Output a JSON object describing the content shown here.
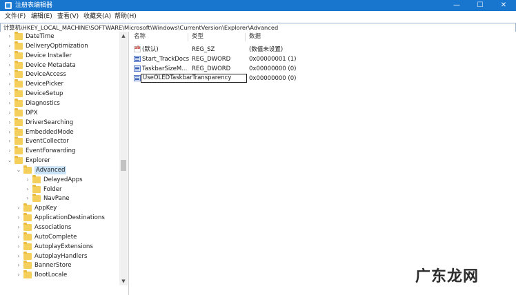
{
  "window": {
    "title": "注册表编辑器"
  },
  "window_controls": {
    "minimize": "—",
    "maximize": "☐",
    "close": "✕"
  },
  "menu": [
    "文件(F)",
    "编辑(E)",
    "查看(V)",
    "收藏夹(A)",
    "帮助(H)"
  ],
  "address": "计算机\\HKEY_LOCAL_MACHINE\\SOFTWARE\\Microsoft\\Windows\\CurrentVersion\\Explorer\\Advanced",
  "tree": {
    "items": [
      {
        "label": "DateTime",
        "expanded": false
      },
      {
        "label": "DeliveryOptimization",
        "expanded": false
      },
      {
        "label": "Device Installer",
        "expanded": false
      },
      {
        "label": "Device Metadata",
        "expanded": false
      },
      {
        "label": "DeviceAccess",
        "expanded": false
      },
      {
        "label": "DevicePicker",
        "expanded": false
      },
      {
        "label": "DeviceSetup",
        "expanded": false
      },
      {
        "label": "Diagnostics",
        "expanded": false
      },
      {
        "label": "DPX",
        "expanded": false
      },
      {
        "label": "DriverSearching",
        "expanded": false
      },
      {
        "label": "EmbeddedMode",
        "expanded": false
      },
      {
        "label": "EventCollector",
        "expanded": false
      },
      {
        "label": "EventForwarding",
        "expanded": false
      },
      {
        "label": "Explorer",
        "expanded": true
      },
      {
        "label": "Advanced",
        "expanded": true,
        "selected": true
      },
      {
        "label": "DelayedApps",
        "expanded": false
      },
      {
        "label": "Folder",
        "expanded": false
      },
      {
        "label": "NavPane",
        "expanded": false
      },
      {
        "label": "AppKey",
        "expanded": false
      },
      {
        "label": "ApplicationDestinations",
        "expanded": false
      },
      {
        "label": "Associations",
        "expanded": false
      },
      {
        "label": "AutoComplete",
        "expanded": false
      },
      {
        "label": "AutoplayExtensions",
        "expanded": false
      },
      {
        "label": "AutoplayHandlers",
        "expanded": false
      },
      {
        "label": "BannerStore",
        "expanded": false
      },
      {
        "label": "BootLocale",
        "expanded": false
      }
    ]
  },
  "values_table": {
    "headers": [
      "名称",
      "类型",
      "数据"
    ],
    "rows": [
      {
        "icon": "string-value-icon",
        "name": "(默认)",
        "type": "REG_SZ",
        "data": "(数值未设置)"
      },
      {
        "icon": "dword-value-icon",
        "name": "Start_TrackDocs",
        "type": "REG_DWORD",
        "data": "0x00000001 (1)"
      },
      {
        "icon": "dword-value-icon",
        "name": "TaskbarSizeM...",
        "type": "REG_DWORD",
        "data": "0x00000000 (0)"
      },
      {
        "icon": "dword-value-icon",
        "name": "UseOLEDTaskbarTransparency",
        "type": "",
        "data": "0x00000000 (0)",
        "editing": true
      }
    ]
  },
  "watermark": "广东龙网",
  "colors": {
    "titlebar": "#1976cf",
    "selection": "#cce4f7",
    "folder": "#f4cf5b"
  }
}
